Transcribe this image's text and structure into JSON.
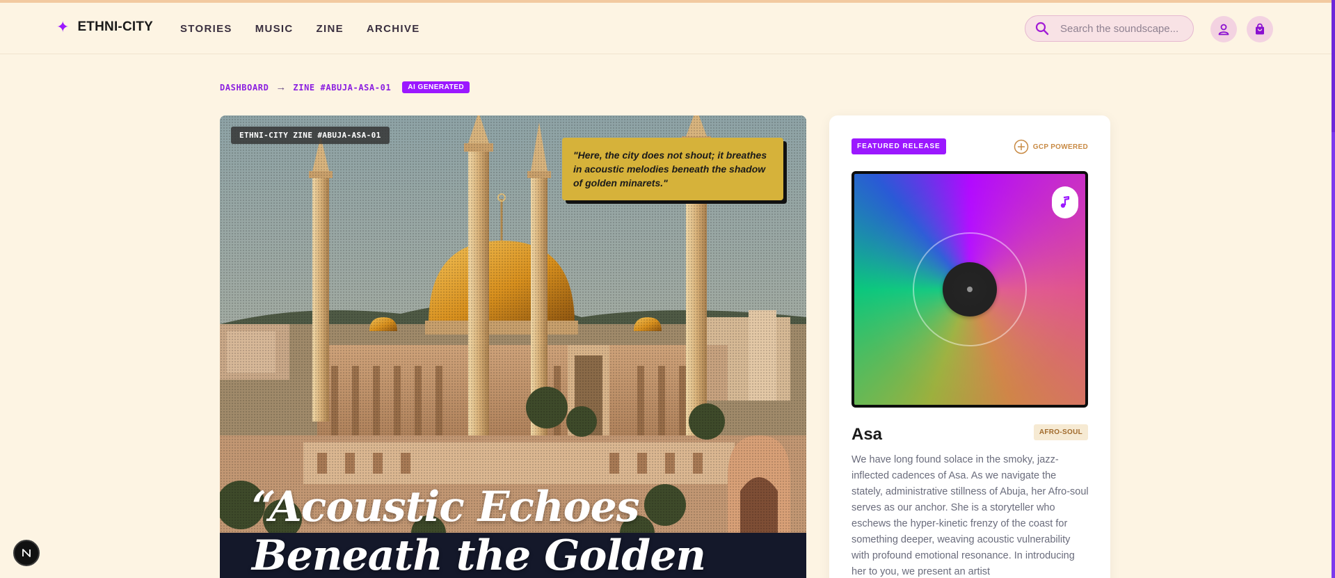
{
  "nav": {
    "brand": "ETHNI-CITY",
    "links": [
      "STORIES",
      "MUSIC",
      "ZINE",
      "ARCHIVE"
    ],
    "search_placeholder": "Search the soundscape..."
  },
  "breadcrumb": {
    "root": "DASHBOARD",
    "arrow": "→",
    "current": "ZINE #ABUJA-ASA-01",
    "badge": "AI GENERATED"
  },
  "hero": {
    "tag": "ETHNI-CITY ZINE #ABUJA-ASA-01",
    "quote": "\"Here, the city does not shout; it breathes in acoustic melodies beneath the shadow of golden minarets.\"",
    "title": "“Acoustic Echoes Beneath the Golden"
  },
  "card": {
    "featured_label": "FEATURED RELEASE",
    "gcp_label": "GCP POWERED",
    "artist": "Asa",
    "genre": "AFRO-SOUL",
    "description": "We have long found solace in the smoky, jazz-inflected cadences of Asa. As we navigate the stately, administrative stillness of Abuja, her Afro-soul serves as our anchor. She is a storyteller who eschews the hyper-kinetic frenzy of the coast for something deeper, weaving acoustic vulnerability with profound emotional resonance. In introducing her to you, we present an artist"
  },
  "dev_badge": "N",
  "colors": {
    "accent": "#9b18ff",
    "background": "#fdf4e3",
    "quote_card": "#d6b23a"
  }
}
